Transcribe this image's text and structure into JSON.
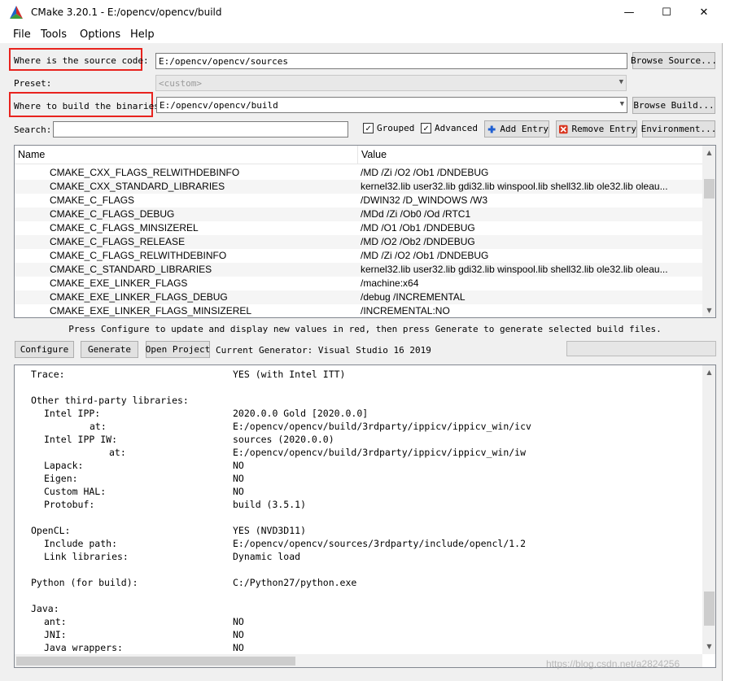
{
  "window": {
    "title": "CMake 3.20.1 - E:/opencv/opencv/build",
    "minimize": "—",
    "maximize": "☐",
    "close": "✕"
  },
  "menu": {
    "file": "File",
    "tools": "Tools",
    "options": "Options",
    "help": "Help"
  },
  "source": {
    "label": "Where is the source code:",
    "value": "E:/opencv/opencv/sources",
    "browse": "Browse Source..."
  },
  "preset": {
    "label": "Preset:",
    "value": "<custom>"
  },
  "build": {
    "label": "Where to build the binaries:",
    "value": "E:/opencv/opencv/build",
    "browse": "Browse Build..."
  },
  "search": {
    "label": "Search:",
    "value": "",
    "grouped_label": "Grouped",
    "grouped_checked": true,
    "advanced_label": "Advanced",
    "advanced_checked": true,
    "add_entry": "Add Entry",
    "remove_entry": "Remove Entry",
    "environment": "Environment..."
  },
  "table": {
    "col_name": "Name",
    "col_value": "Value",
    "rows": [
      {
        "name": "CMAKE_CXX_FLAGS_RELWITHDEBINFO",
        "value": "/MD /Zi /O2 /Ob1 /DNDEBUG"
      },
      {
        "name": "CMAKE_CXX_STANDARD_LIBRARIES",
        "value": "kernel32.lib user32.lib gdi32.lib winspool.lib shell32.lib ole32.lib oleau..."
      },
      {
        "name": "CMAKE_C_FLAGS",
        "value": "/DWIN32 /D_WINDOWS /W3"
      },
      {
        "name": "CMAKE_C_FLAGS_DEBUG",
        "value": "/MDd /Zi /Ob0 /Od /RTC1"
      },
      {
        "name": "CMAKE_C_FLAGS_MINSIZEREL",
        "value": "/MD /O1 /Ob1 /DNDEBUG"
      },
      {
        "name": "CMAKE_C_FLAGS_RELEASE",
        "value": "/MD /O2 /Ob2 /DNDEBUG"
      },
      {
        "name": "CMAKE_C_FLAGS_RELWITHDEBINFO",
        "value": "/MD /Zi /O2 /Ob1 /DNDEBUG"
      },
      {
        "name": "CMAKE_C_STANDARD_LIBRARIES",
        "value": "kernel32.lib user32.lib gdi32.lib winspool.lib shell32.lib ole32.lib oleau..."
      },
      {
        "name": "CMAKE_EXE_LINKER_FLAGS",
        "value": "/machine:x64"
      },
      {
        "name": "CMAKE_EXE_LINKER_FLAGS_DEBUG",
        "value": "/debug /INCREMENTAL"
      },
      {
        "name": "CMAKE_EXE_LINKER_FLAGS_MINSIZEREL",
        "value": "/INCREMENTAL:NO"
      }
    ]
  },
  "hint": "Press Configure to update and display new values in red, then press Generate to generate selected build files.",
  "actions": {
    "configure": "Configure",
    "generate": "Generate",
    "open_project": "Open Project",
    "current_generator": "Current Generator: Visual Studio 16 2019"
  },
  "output": [
    {
      "key": "Trace:",
      "value": "YES (with Intel ITT)",
      "indent": 0
    },
    {
      "key": "",
      "value": "",
      "indent": 0
    },
    {
      "key": "Other third-party libraries:",
      "value": "",
      "indent": 0
    },
    {
      "key": "Intel IPP:",
      "value": "2020.0.0 Gold [2020.0.0]",
      "indent": 1
    },
    {
      "key": "at:",
      "value": "E:/opencv/opencv/build/3rdparty/ippicv/ippicv_win/icv",
      "indent": 4
    },
    {
      "key": "Intel IPP IW:",
      "value": "sources (2020.0.0)",
      "indent": 1
    },
    {
      "key": "at:",
      "value": "E:/opencv/opencv/build/3rdparty/ippicv/ippicv_win/iw",
      "indent": 5
    },
    {
      "key": "Lapack:",
      "value": "NO",
      "indent": 1
    },
    {
      "key": "Eigen:",
      "value": "NO",
      "indent": 1
    },
    {
      "key": "Custom HAL:",
      "value": "NO",
      "indent": 1
    },
    {
      "key": "Protobuf:",
      "value": "build (3.5.1)",
      "indent": 1
    },
    {
      "key": "",
      "value": "",
      "indent": 0
    },
    {
      "key": "OpenCL:",
      "value": "YES (NVD3D11)",
      "indent": 0
    },
    {
      "key": "Include path:",
      "value": "E:/opencv/opencv/sources/3rdparty/include/opencl/1.2",
      "indent": 1
    },
    {
      "key": "Link libraries:",
      "value": "Dynamic load",
      "indent": 1
    },
    {
      "key": "",
      "value": "",
      "indent": 0
    },
    {
      "key": "Python (for build):",
      "value": "C:/Python27/python.exe",
      "indent": 0
    },
    {
      "key": "",
      "value": "",
      "indent": 0
    },
    {
      "key": "Java:",
      "value": "",
      "indent": 0
    },
    {
      "key": "ant:",
      "value": "NO",
      "indent": 1
    },
    {
      "key": "JNI:",
      "value": "NO",
      "indent": 1
    },
    {
      "key": "Java wrappers:",
      "value": "NO",
      "indent": 1
    }
  ],
  "watermark": "https://blog.csdn.net/a2824256",
  "colors": {
    "highlight_box": "#e8231e",
    "add_icon": "#1f5fd1",
    "remove_icon": "#d9341e"
  }
}
